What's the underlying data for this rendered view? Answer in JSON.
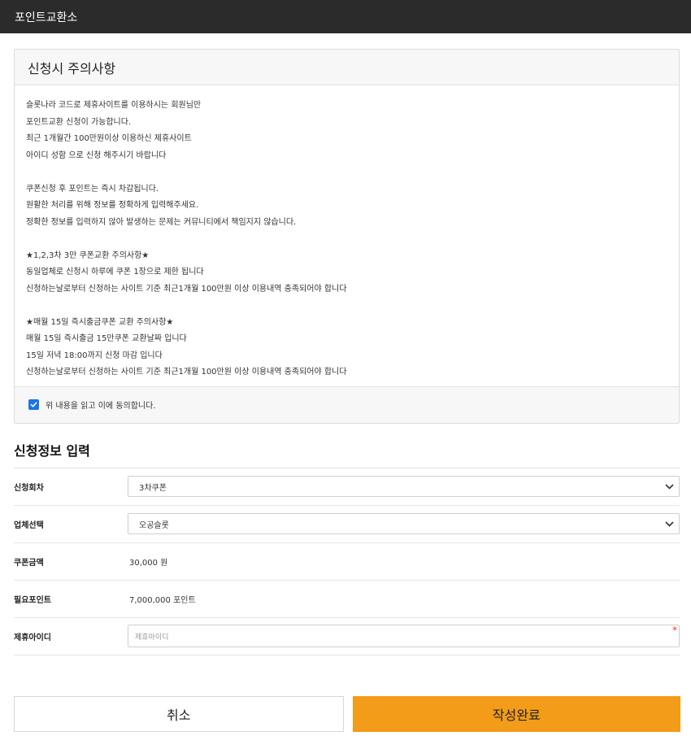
{
  "app": {
    "title": "포인트교환소"
  },
  "notice": {
    "title": "신청시 주의사항",
    "paragraphs": [
      [
        "슬롯나라 코드로 제휴사이트를 이용하시는 회원님만",
        "포인트교환 신청이 가능합니다.",
        "최근 1개월간 100만원이상 이용하신 제휴사이트",
        "아이디 성함 으로 신청 해주시기 바랍니다"
      ],
      [
        "쿠폰신청 후 포인트는 즉시 차감됩니다.",
        "원활한 처리를 위해 정보를 정확하게 입력해주세요.",
        "정확한 정보를 입력하지 않아 발생하는 문제는 커뮤니티에서 책임지지 않습니다."
      ],
      [
        "★1,2,3차 3만 쿠폰교환 주의사항★",
        "동일업체로 신청시 하루에 쿠폰 1장으로 제한 됩니다",
        "신청하는날로부터 신청하는 사이트 기준 최근1개월 100만원 이상 이용내역 충족되어야 합니다"
      ],
      [
        "★매월 15일 즉시출금쿠폰 교환 주의사항★",
        "매월 15일 즉시출금 15만쿠폰 교환날짜 입니다",
        "15일 저녁 18:00까지 신청 마감 입니다",
        "신청하는날로부터 신청하는 사이트 기준 최근1개월 100만원 이상 이용내역 충족되어야 합니다"
      ]
    ],
    "agree_label": "위 내용을 읽고 이에 동의합니다.",
    "agree_checked": true
  },
  "form": {
    "title": "신청정보 입력",
    "round": {
      "label": "신청회차",
      "value": "3차쿠폰"
    },
    "company": {
      "label": "업체선택",
      "value": "오공슬롯"
    },
    "coupon_amount": {
      "label": "쿠폰금액",
      "value": "30,000 원"
    },
    "required_points": {
      "label": "필요포인트",
      "value": "7,000,000 포인트"
    },
    "partner_id": {
      "label": "제휴아이디",
      "placeholder": "제휴아이디",
      "value": "",
      "required_mark": "*"
    }
  },
  "actions": {
    "cancel_label": "취소",
    "submit_label": "작성완료"
  },
  "colors": {
    "topbar": "#2b2b2b",
    "accent": "#f39c19",
    "checkbox": "#1a73e8",
    "required": "#e5392f"
  }
}
